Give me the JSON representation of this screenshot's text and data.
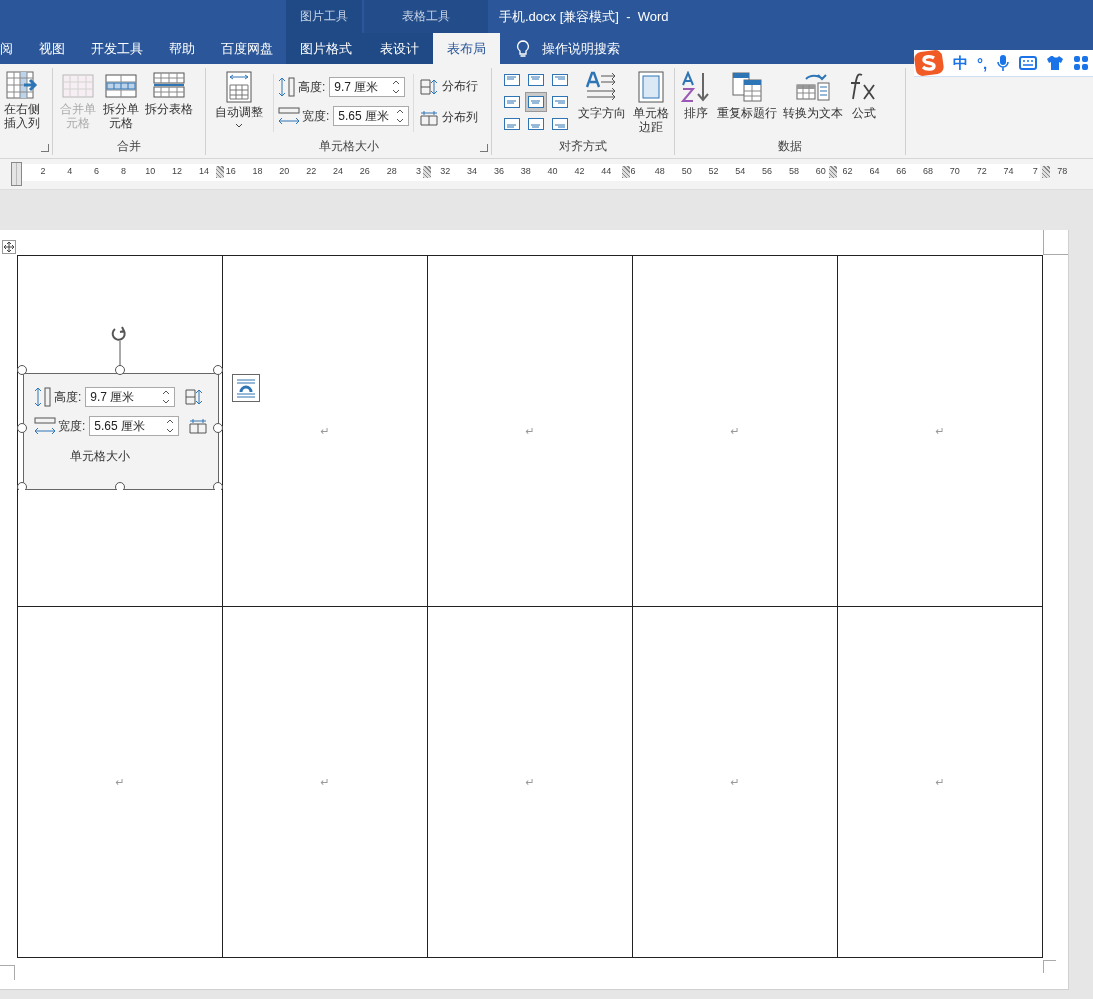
{
  "title_bar": {
    "context_groups": [
      {
        "label": "图片工具"
      },
      {
        "label": "表格工具"
      }
    ],
    "title": "手机.docx [兼容模式]  -  Word"
  },
  "tabs": [
    {
      "label": "阅",
      "selected": false,
      "context": false
    },
    {
      "label": "视图",
      "selected": false,
      "context": false
    },
    {
      "label": "开发工具",
      "selected": false,
      "context": false
    },
    {
      "label": "帮助",
      "selected": false,
      "context": false
    },
    {
      "label": "百度网盘",
      "selected": false,
      "context": false
    },
    {
      "label": "图片格式",
      "selected": false,
      "context": true
    },
    {
      "label": "表设计",
      "selected": false,
      "context": true
    },
    {
      "label": "表布局",
      "selected": true,
      "context": true
    }
  ],
  "tell_me": "操作说明搜索",
  "ime_bar": {
    "items": [
      "中",
      "°,"
    ]
  },
  "ribbon": {
    "groups": [
      {
        "launcher": true,
        "buttons": [
          {
            "label": "在右侧插入列",
            "kind": "stacked",
            "disabled": false
          }
        ]
      },
      {
        "label": "合并",
        "launcher": false,
        "buttons": [
          {
            "label": "合并单元格",
            "kind": "stacked",
            "disabled": true
          },
          {
            "label": "拆分单元格",
            "kind": "stacked",
            "disabled": false
          },
          {
            "label": "拆分表格",
            "kind": "wide",
            "disabled": false
          }
        ]
      },
      {
        "label": "单元格大小",
        "launcher": true,
        "autofit": "自动调整",
        "height_label": "高度:",
        "height_value": "9.7 厘米",
        "width_label": "宽度:",
        "width_value": "5.65 厘米",
        "distribute_rows": "分布行",
        "distribute_cols": "分布列"
      },
      {
        "label": "对齐方式",
        "launcher": false,
        "alignments": [
          {
            "selected": false
          },
          {
            "selected": false
          },
          {
            "selected": false
          },
          {
            "selected": false
          },
          {
            "selected": true
          },
          {
            "selected": false
          },
          {
            "selected": false
          },
          {
            "selected": false
          },
          {
            "selected": false
          }
        ],
        "buttons": [
          {
            "label": "文字方向",
            "kind": "wide",
            "disabled": false
          },
          {
            "label": "单元格边距",
            "kind": "stacked",
            "disabled": false
          }
        ]
      },
      {
        "label": "数据",
        "launcher": false,
        "buttons": [
          {
            "label": "排序",
            "kind": "wide",
            "disabled": false
          },
          {
            "label": "重复标题行",
            "kind": "wide",
            "disabled": false
          },
          {
            "label": "转换为文本",
            "kind": "wide",
            "disabled": false
          },
          {
            "label": "公式",
            "kind": "wide",
            "disabled": false
          }
        ]
      }
    ]
  },
  "ruler": {
    "labels": [
      "2",
      "4",
      "6",
      "8",
      "10",
      "12",
      "14",
      "16",
      "18",
      "20",
      "22",
      "24",
      "26",
      "28",
      "3",
      "32",
      "34",
      "36",
      "38",
      "40",
      "42",
      "44",
      "6",
      "48",
      "50",
      "52",
      "54",
      "56",
      "58",
      "60",
      "62",
      "64",
      "66",
      "68",
      "70",
      "72",
      "74",
      "7",
      "78"
    ]
  },
  "table": {
    "rows": [
      {
        "cells": [
          {
            "kind": "image",
            "height_label": "高度:",
            "height_value": "9.7 厘米",
            "width_label": "宽度:",
            "width_value": "5.65 厘米",
            "group_label": "单元格大小",
            "selected": true
          },
          {
            "kind": "text",
            "text": "↵"
          },
          {
            "kind": "text",
            "text": "↵"
          },
          {
            "kind": "text",
            "text": "↵"
          },
          {
            "kind": "text",
            "text": "↵"
          }
        ]
      },
      {
        "cells": [
          {
            "kind": "text",
            "text": "↵"
          },
          {
            "kind": "text",
            "text": "↵"
          },
          {
            "kind": "text",
            "text": "↵"
          },
          {
            "kind": "text",
            "text": "↵"
          },
          {
            "kind": "text",
            "text": "↵"
          }
        ]
      }
    ]
  }
}
